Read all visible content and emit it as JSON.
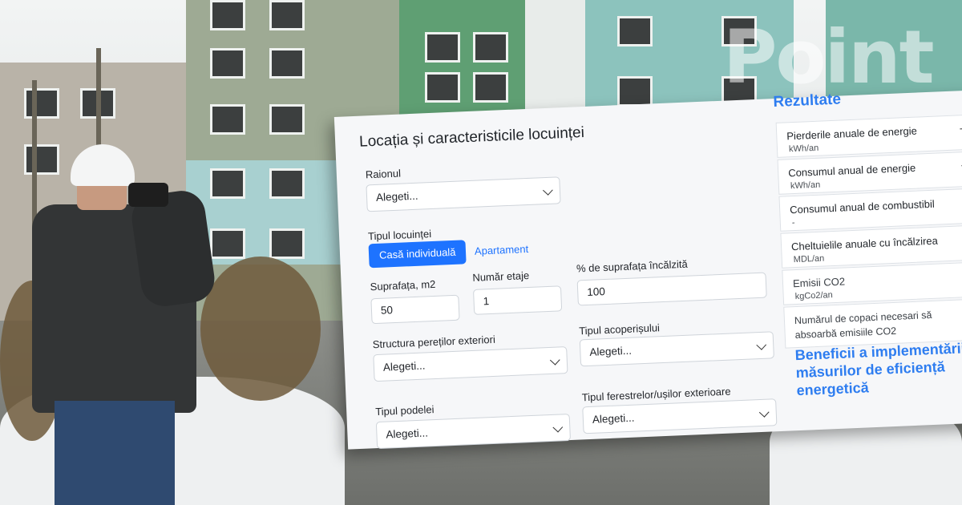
{
  "watermark": "Point",
  "form": {
    "title": "Locația și caracteristicile locuinței",
    "raion": {
      "label": "Raionul",
      "value": "Alegeti..."
    },
    "housing_type": {
      "label": "Tipul locuinței",
      "options": [
        "Casă individuală",
        "Apartament"
      ],
      "selected": "Casă individuală"
    },
    "area": {
      "label": "Suprafața, m2",
      "value": "50"
    },
    "floors": {
      "label": "Număr etaje",
      "value": "1"
    },
    "heated": {
      "label": "% de suprafața încălzită",
      "value": "100"
    },
    "walls": {
      "label": "Structura pereților exteriori",
      "value": "Alegeti..."
    },
    "roof": {
      "label": "Tipul acoperișului",
      "value": "Alegeti..."
    },
    "floor_type": {
      "label": "Tipul podelei",
      "value": "Alegeti..."
    },
    "windows": {
      "label": "Tipul ferestrelor/ușilor exterioare",
      "value": "Alegeti..."
    }
  },
  "results": {
    "title": "Rezultate",
    "items": [
      {
        "name": "Pierderile anuale de energie",
        "unit": "kWh/an",
        "value": "-"
      },
      {
        "name": "Consumul anual de energie",
        "unit": "kWh/an",
        "value": "-"
      },
      {
        "name": "Consumul anual de combustibil",
        "unit": "-",
        "value": "-"
      },
      {
        "name": "Cheltuielile anuale cu încălzirea",
        "unit": "MDL/an",
        "value": "-"
      },
      {
        "name": "Emisii CO2",
        "unit": "kgCo2/an",
        "value": "-"
      },
      {
        "name": "Numărul de copaci necesari să absoarbă emisiile CO2",
        "unit": "",
        "value": "-"
      }
    ]
  },
  "benefits": {
    "title": "Beneficii a implementării măsurilor de eficiență energetică"
  }
}
